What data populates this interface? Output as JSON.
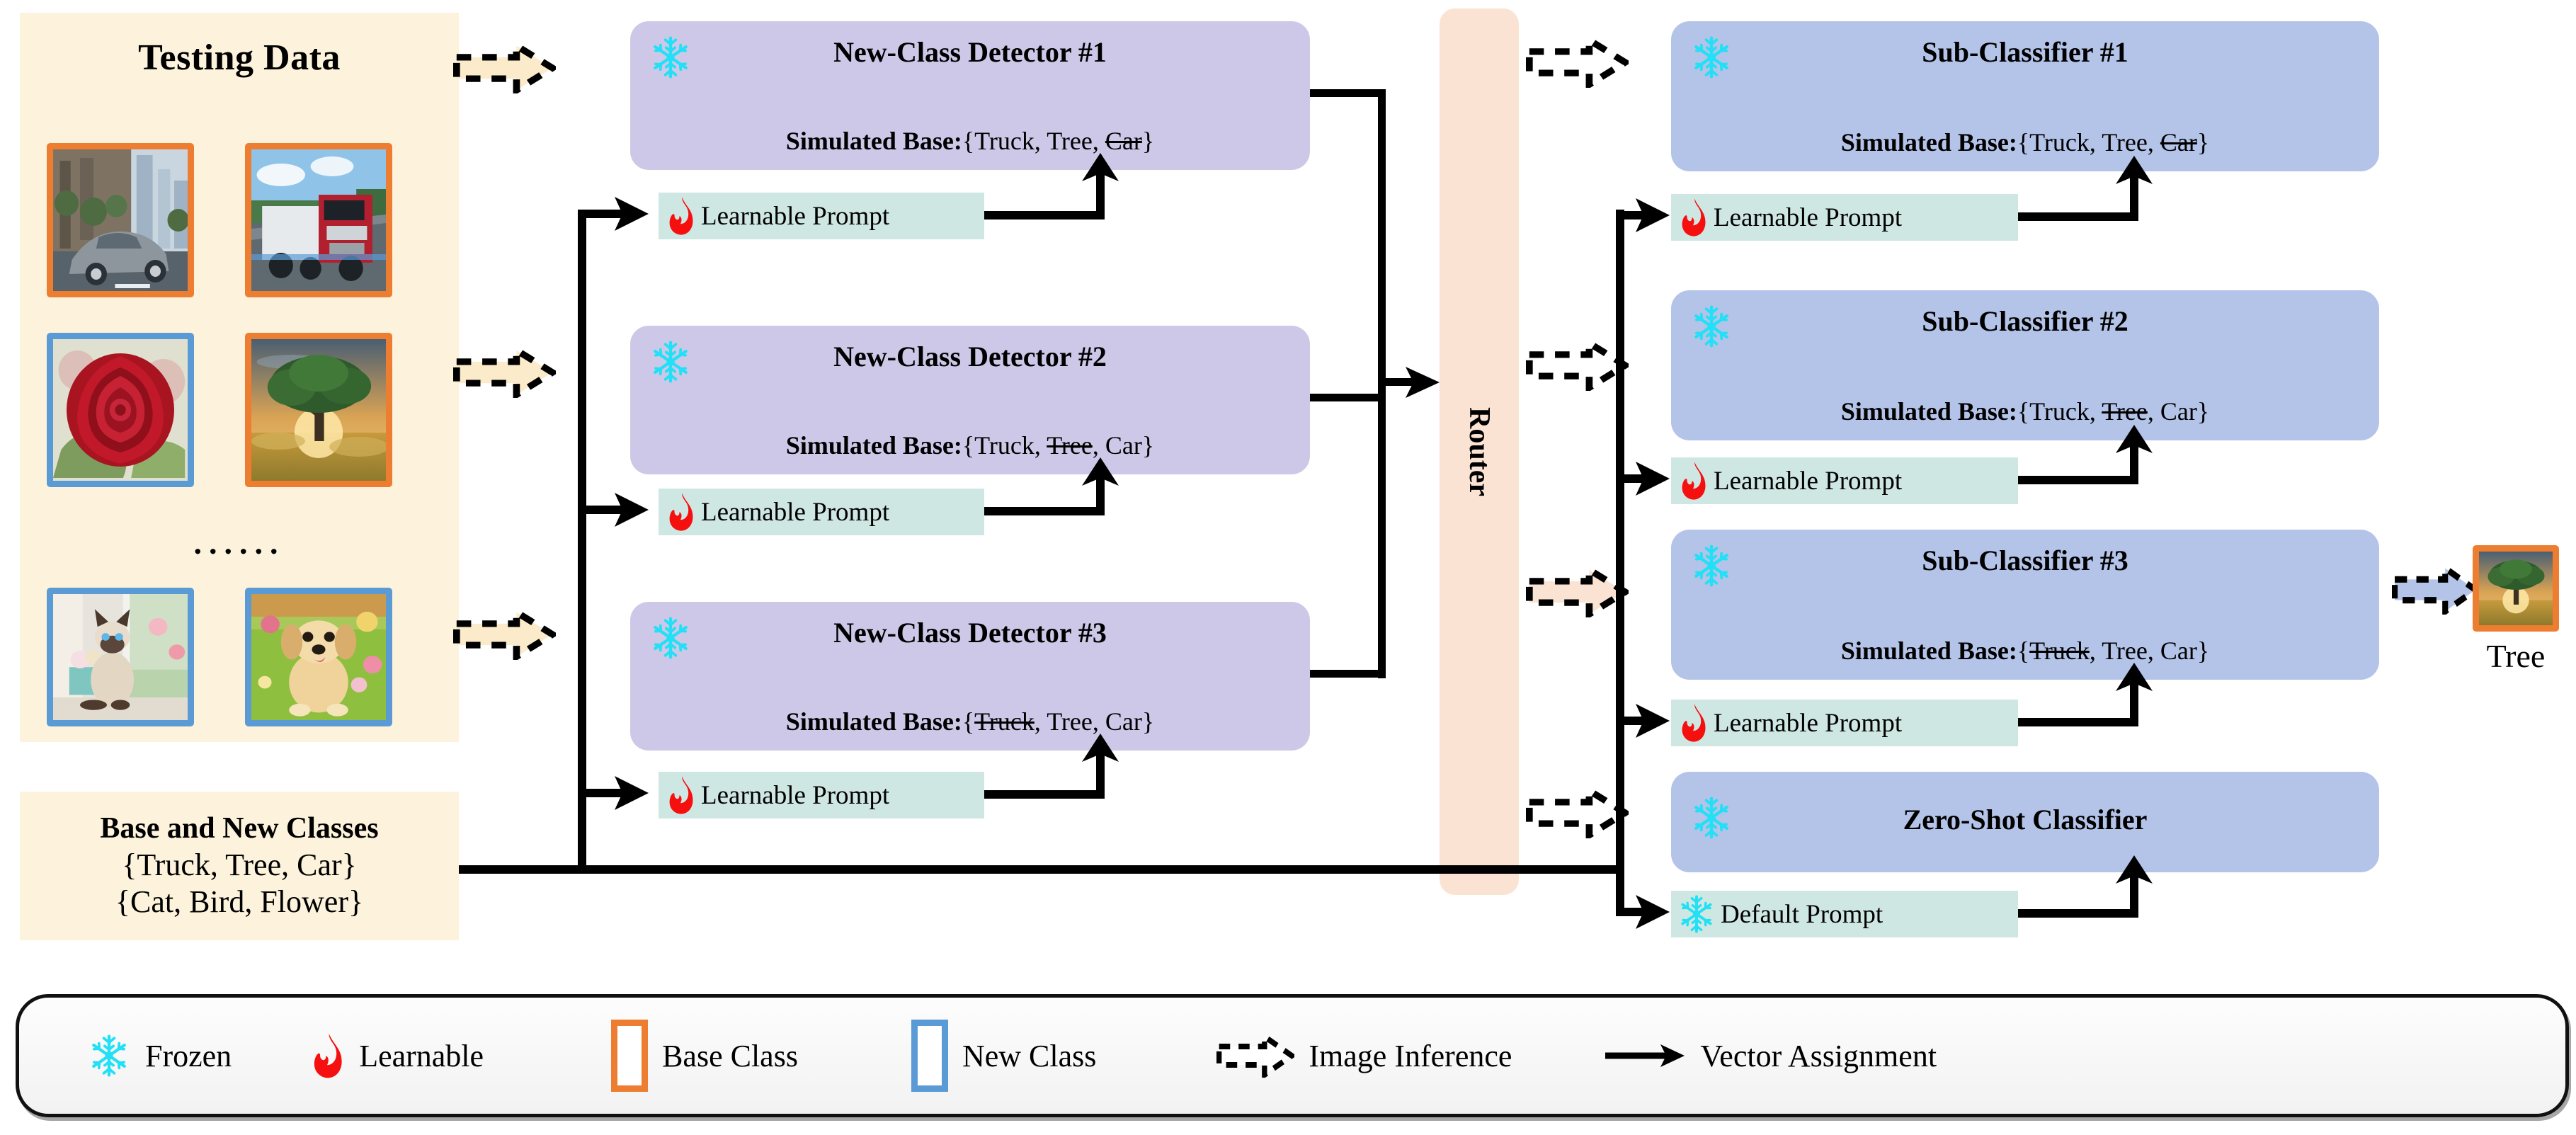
{
  "testing_panel": {
    "title": "Testing Data",
    "ellipsis": "......",
    "images": [
      {
        "name": "car-thumbnail",
        "border": "base",
        "alt": "silver car on city street"
      },
      {
        "name": "truck-thumbnail",
        "border": "base",
        "alt": "red semi truck on highway"
      },
      {
        "name": "rose-thumbnail",
        "border": "new",
        "alt": "red rose closeup"
      },
      {
        "name": "tree-thumbnail",
        "border": "base",
        "alt": "oak tree at sunset"
      },
      {
        "name": "cat-thumbnail",
        "border": "new",
        "alt": "siamese cat at window"
      },
      {
        "name": "dog-thumbnail",
        "border": "new",
        "alt": "golden retriever puppy on grass"
      }
    ]
  },
  "classes_panel": {
    "title": "Base and New Classes",
    "base_set": "{Truck, Tree, Car}",
    "new_set": "{Cat, Bird, Flower}"
  },
  "detectors": [
    {
      "title": "New-Class Detector #1",
      "sub_prefix": "Simulated Base:",
      "open": "{",
      "items": [
        "Truck",
        "Tree",
        "Car"
      ],
      "struck": "Car",
      "close": "}",
      "prompt": "Learnable  Prompt",
      "prompt_icon": "flame-icon"
    },
    {
      "title": "New-Class Detector #2",
      "sub_prefix": "Simulated Base:",
      "open": "{",
      "items": [
        "Truck",
        "Tree",
        "Car"
      ],
      "struck": "Tree",
      "close": "}",
      "prompt": "Learnable  Prompt",
      "prompt_icon": "flame-icon"
    },
    {
      "title": "New-Class Detector #3",
      "sub_prefix": "Simulated Base:",
      "open": "{",
      "items": [
        "Truck",
        "Tree",
        "Car"
      ],
      "struck": "Truck",
      "close": "}",
      "prompt": "Learnable  Prompt",
      "prompt_icon": "flame-icon"
    }
  ],
  "router": {
    "label": "Router"
  },
  "classifiers": [
    {
      "title": "Sub-Classifier #1",
      "sub_prefix": "Simulated Base:",
      "open": "{",
      "items": [
        "Truck",
        "Tree",
        "Car"
      ],
      "struck": "Car",
      "close": "}",
      "prompt": "Learnable  Prompt",
      "prompt_icon": "flame-icon"
    },
    {
      "title": "Sub-Classifier #2",
      "sub_prefix": "Simulated Base:",
      "open": "{",
      "items": [
        "Truck",
        "Tree",
        "Car"
      ],
      "struck": "Tree",
      "close": "}",
      "prompt": "Learnable  Prompt",
      "prompt_icon": "flame-icon"
    },
    {
      "title": "Sub-Classifier #3",
      "sub_prefix": "Simulated Base:",
      "open": "{",
      "items": [
        "Truck",
        "Tree",
        "Car"
      ],
      "struck": "Truck",
      "close": "}",
      "prompt": "Learnable  Prompt",
      "prompt_icon": "flame-icon"
    },
    {
      "title": "Zero-Shot Classifier",
      "sub_prefix": "",
      "open": "",
      "items": [],
      "struck": "",
      "close": "",
      "prompt": "Default  Prompt",
      "prompt_icon": "snowflake-icon"
    }
  ],
  "output": {
    "label": "Tree",
    "image_alt": "oak tree at sunset",
    "border": "base"
  },
  "legend": {
    "items": [
      {
        "icon": "snowflake-icon",
        "label": "Frozen"
      },
      {
        "icon": "flame-icon",
        "label": "Learnable"
      },
      {
        "icon": "orange-square-icon",
        "label": "Base Class"
      },
      {
        "icon": "blue-square-icon",
        "label": "New Class"
      },
      {
        "icon": "dashed-block-arrow-icon",
        "label": "Image Inference"
      },
      {
        "icon": "solid-arrow-icon",
        "label": "Vector Assignment"
      }
    ]
  },
  "colors": {
    "panel_cream": "#FDF3DC",
    "detector_purple": "#CEC8E8",
    "classifier_blue": "#B4C3E8",
    "prompt_teal": "#CFE7E3",
    "router_peach": "#FAE3D3",
    "base_border": "#ED7D31",
    "new_border": "#5B9BD5",
    "snowflake": "#22E0F5",
    "flame": "#F50F0F",
    "arrow_cream": "#FBEBCB",
    "arrow_blue": "#B4C3E8"
  }
}
